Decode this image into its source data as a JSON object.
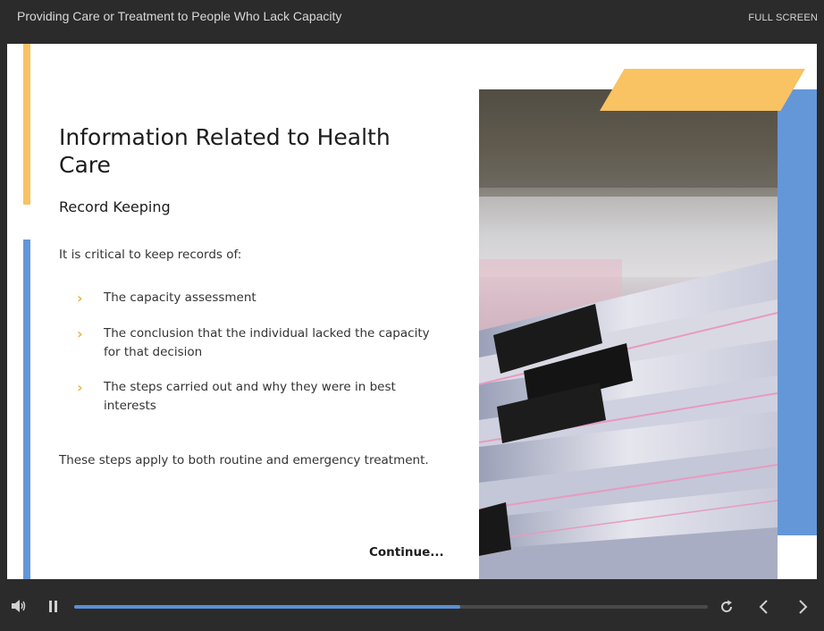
{
  "header": {
    "course_title": "Providing Care or Treatment to People Who Lack Capacity",
    "fullscreen_label": "FULL SCREEN"
  },
  "slide": {
    "title": "Information Related to Health Care",
    "subtitle": "Record Keeping",
    "intro": "It is critical to keep records of:",
    "bullets": [
      "The capacity assessment",
      "The conclusion that the individual lacked the capacity for that decision",
      "The steps carried out and why they were in best interests"
    ],
    "closing": "These steps apply to both routine and emergency treatment.",
    "continue_label": "Continue...",
    "photo_icon": "binder-clipped-documents-photo"
  },
  "controls": {
    "progress_fraction": 0.61,
    "icons": [
      "volume-icon",
      "pause-icon",
      "replay-icon",
      "chevron-left-icon",
      "chevron-right-icon"
    ]
  },
  "colors": {
    "accent_yellow": "#f9c262",
    "accent_blue": "#6497d8",
    "chevron": "#f0b547",
    "progress": "#5b8fd6",
    "chrome": "#2b2b2b"
  }
}
